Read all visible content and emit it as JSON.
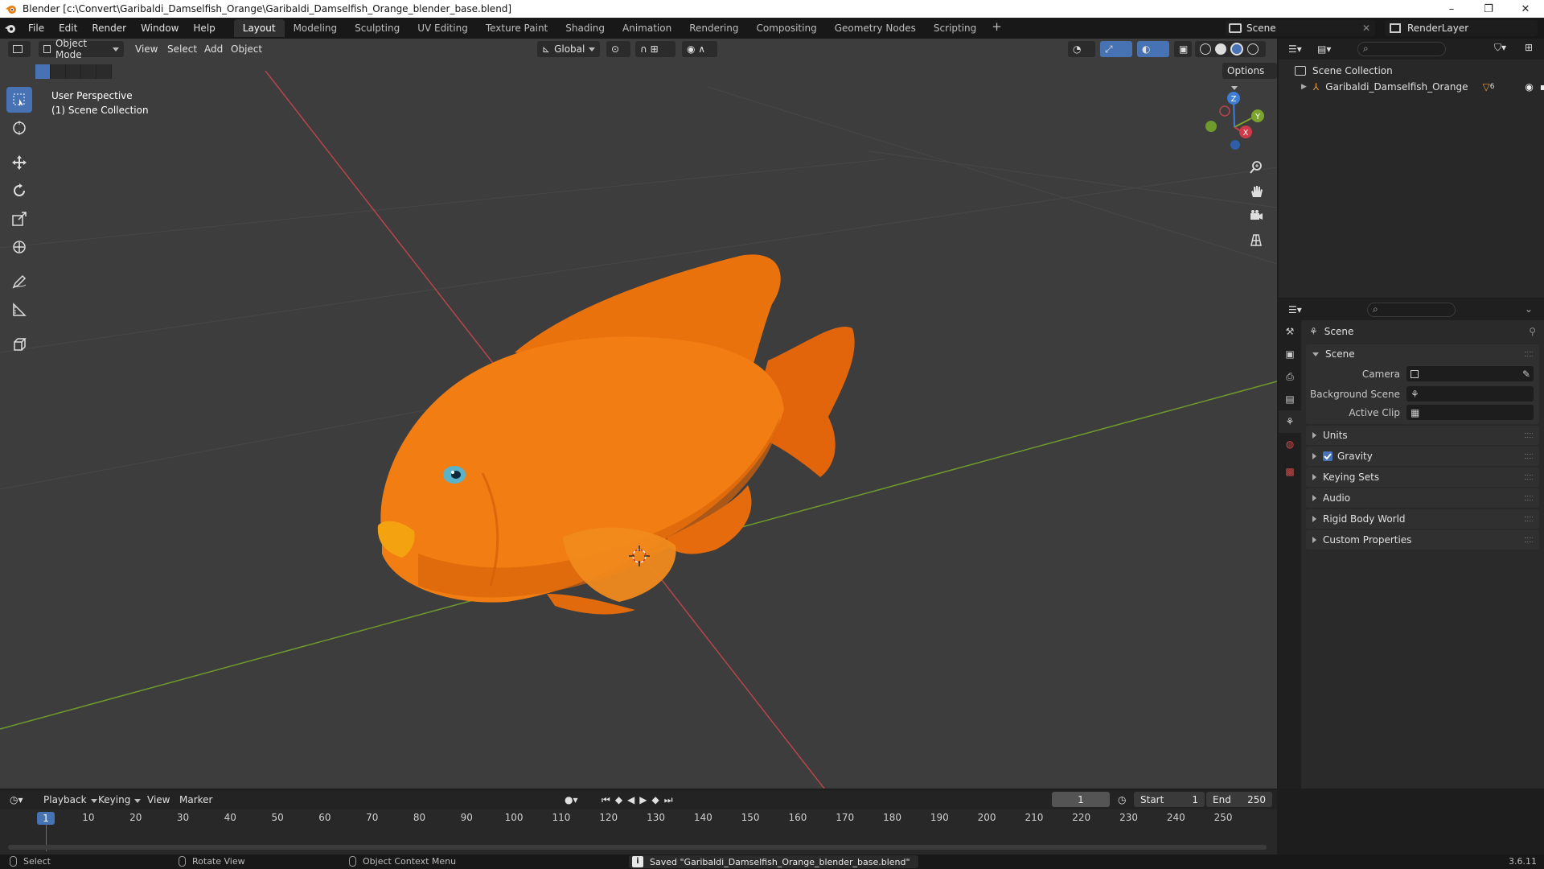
{
  "window": {
    "title": "Blender [c:\\Convert\\Garibaldi_Damselfish_Orange\\Garibaldi_Damselfish_Orange_blender_base.blend]",
    "minimize": "–",
    "maximize": "❐",
    "close": "✕"
  },
  "menubar": {
    "items": [
      "File",
      "Edit",
      "Render",
      "Window",
      "Help"
    ],
    "workspaces": [
      "Layout",
      "Modeling",
      "Sculpting",
      "UV Editing",
      "Texture Paint",
      "Shading",
      "Animation",
      "Rendering",
      "Compositing",
      "Geometry Nodes",
      "Scripting"
    ],
    "add_workspace": "+",
    "scene": "Scene",
    "view_layer": "RenderLayer"
  },
  "viewport": {
    "mode": "Object Mode",
    "menus": [
      "View",
      "Select",
      "Add",
      "Object"
    ],
    "transform_orientation": "Global",
    "options": "Options",
    "perspective": "User Perspective",
    "collection": "(1) Scene Collection",
    "gizmo": {
      "x": "X",
      "y": "Y",
      "z": "Z"
    }
  },
  "outliner": {
    "root": "Scene Collection",
    "object": "Garibaldi_Damselfish_Orange",
    "modifier_count": "6"
  },
  "properties": {
    "context": "Scene",
    "panels": {
      "scene": "Scene",
      "camera_label": "Camera",
      "background_label": "Background Scene",
      "clip_label": "Active Clip",
      "units": "Units",
      "gravity": "Gravity",
      "keying_sets": "Keying Sets",
      "audio": "Audio",
      "rigid_body_world": "Rigid Body World",
      "custom_properties": "Custom Properties"
    }
  },
  "timeline": {
    "menus": [
      "Playback",
      "Keying",
      "View",
      "Marker"
    ],
    "current_frame": "1",
    "start_label": "Start",
    "start": "1",
    "end_label": "End",
    "end": "250",
    "ticks": [
      "10",
      "20",
      "30",
      "40",
      "50",
      "60",
      "70",
      "80",
      "90",
      "100",
      "110",
      "120",
      "130",
      "140",
      "150",
      "160",
      "170",
      "180",
      "190",
      "200",
      "210",
      "220",
      "230",
      "240",
      "250"
    ],
    "playhead": "1"
  },
  "statusbar": {
    "select": "Select",
    "rotate": "Rotate View",
    "context_menu": "Object Context Menu",
    "message": "Saved \"Garibaldi_Damselfish_Orange_blender_base.blend\"",
    "version": "3.6.11"
  },
  "colors": {
    "accent": "#4772b3",
    "x_axis": "#c2404a",
    "y_axis": "#7ba32e",
    "fish": "#f07a10"
  }
}
